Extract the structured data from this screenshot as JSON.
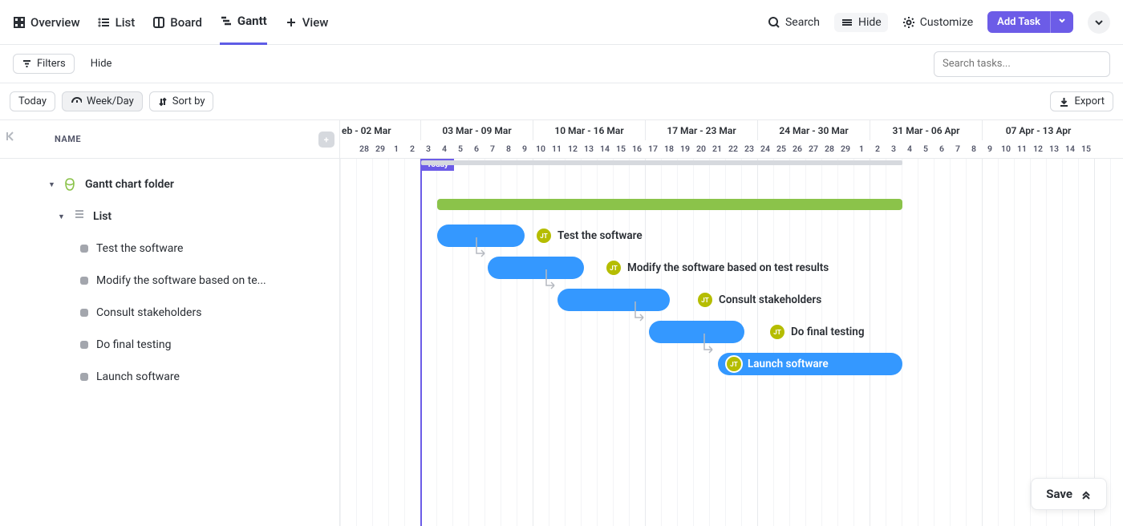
{
  "tabs": [
    {
      "label": "Overview"
    },
    {
      "label": "List"
    },
    {
      "label": "Board"
    },
    {
      "label": "Gantt",
      "active": true
    },
    {
      "label": "View",
      "plus": true
    }
  ],
  "header": {
    "search": "Search",
    "hide": "Hide",
    "customize": "Customize",
    "add_task": "Add Task"
  },
  "row2": {
    "filters": "Filters",
    "hide": "Hide",
    "search_placeholder": "Search tasks..."
  },
  "row3": {
    "today": "Today",
    "weekday": "Week/Day",
    "sortby": "Sort by",
    "export": "Export"
  },
  "left": {
    "name_header": "NAME",
    "folder": "Gantt chart folder",
    "list": "List"
  },
  "tasks": [
    {
      "name": "Test the software"
    },
    {
      "name": "Modify the software based on te..."
    },
    {
      "name": "Consult stakeholders"
    },
    {
      "name": "Do final testing"
    },
    {
      "name": "Launch software"
    }
  ],
  "weeks": [
    "eb - 02 Mar",
    "03 Mar - 09 Mar",
    "10 Mar - 16 Mar",
    "17 Mar - 23 Mar",
    "24 Mar - 30 Mar",
    "31 Mar - 06 Apr",
    "07 Apr - 13 Apr"
  ],
  "days": [
    "",
    "28",
    "29",
    "1",
    "2",
    "3",
    "4",
    "5",
    "6",
    "7",
    "8",
    "9",
    "10",
    "11",
    "12",
    "13",
    "14",
    "15",
    "16",
    "17",
    "18",
    "19",
    "20",
    "21",
    "22",
    "23",
    "24",
    "25",
    "26",
    "27",
    "28",
    "29",
    "1",
    "2",
    "3",
    "4",
    "5",
    "6",
    "7",
    "8",
    "9",
    "10",
    "11",
    "12",
    "13",
    "14",
    "15"
  ],
  "today_label": "Today",
  "avatar": "JT",
  "chart_data": {
    "type": "gantt",
    "timeline_unit": "day",
    "timeline_start": "2025-02-27",
    "today": "2025-03-01",
    "summary_bar": {
      "name": "Gantt chart folder",
      "start": "2025-03-01",
      "end": "2025-03-31"
    },
    "green_bar": {
      "name": "List",
      "start": "2025-03-02",
      "end": "2025-03-31"
    },
    "tasks": [
      {
        "name": "Test the software",
        "start": "2025-03-02",
        "end": "2025-03-07",
        "assignee": "JT"
      },
      {
        "name": "Modify the software based on test results",
        "start": "2025-03-06",
        "end": "2025-03-12",
        "assignee": "JT",
        "depends_on": 0
      },
      {
        "name": "Consult stakeholders",
        "start": "2025-03-11",
        "end": "2025-03-17",
        "assignee": "JT",
        "depends_on": 1
      },
      {
        "name": "Do final testing",
        "start": "2025-03-16",
        "end": "2025-03-22",
        "assignee": "JT",
        "depends_on": 2
      },
      {
        "name": "Launch software",
        "start": "2025-03-21",
        "end": "2025-03-31",
        "assignee": "JT",
        "depends_on": 3,
        "label_inside": true
      }
    ]
  },
  "barlabels": [
    "Test the software",
    "Modify the software based on test results",
    "Consult stakeholders",
    "Do final testing",
    "Launch software"
  ],
  "save": "Save"
}
